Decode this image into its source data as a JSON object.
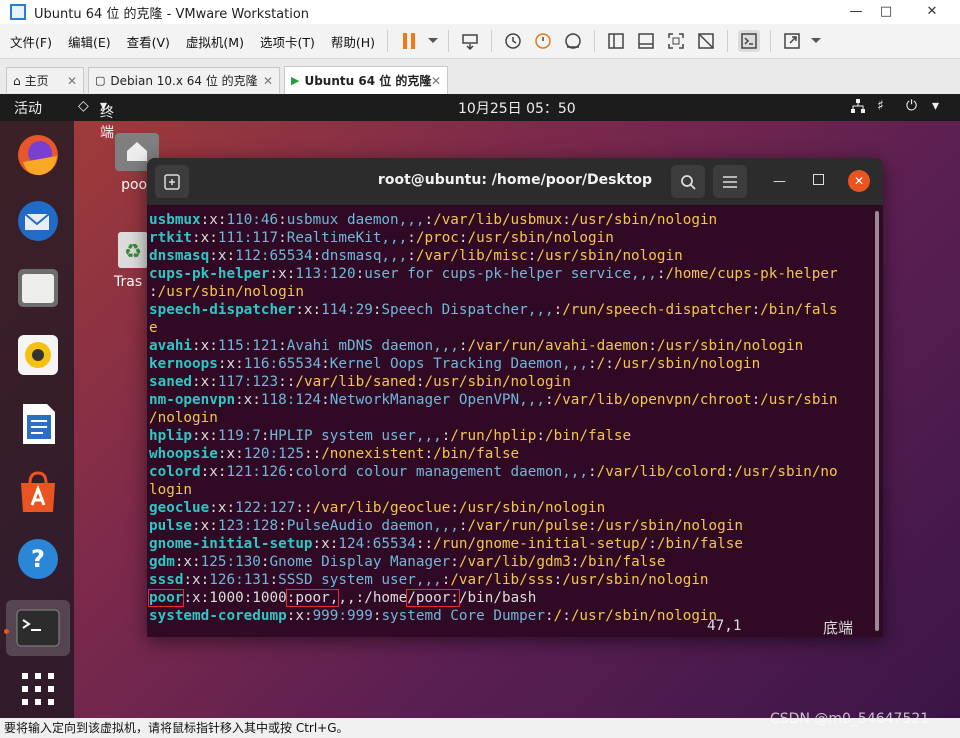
{
  "window": {
    "title": "Ubuntu 64 位 的克隆 - VMware Workstation"
  },
  "menu": [
    "文件(F)",
    "编辑(E)",
    "查看(V)",
    "虚拟机(M)",
    "选项卡(T)",
    "帮助(H)"
  ],
  "tabs": [
    {
      "label": "主页",
      "active": false
    },
    {
      "label": "Debian 10.x 64 位 的克隆",
      "active": false
    },
    {
      "label": "Ubuntu 64 位 的克隆",
      "active": true
    }
  ],
  "topbar": {
    "activities": "活动",
    "app": "终端",
    "clock": "10月25日  05：50"
  },
  "desktop": {
    "home": "poor",
    "trash": "Tras"
  },
  "terminal": {
    "title": "root@ubuntu: /home/poor/Desktop",
    "lines": [
      [
        [
          "u",
          "usbmux"
        ],
        [
          "s",
          ":x:"
        ],
        [
          "n",
          "110:46"
        ],
        [
          "s",
          ":"
        ],
        [
          "n",
          "usbmux daemon,,,"
        ],
        [
          "s",
          ":"
        ],
        [
          "d",
          "/var/lib/usbmux"
        ],
        [
          "s",
          ":"
        ],
        [
          "b",
          "/usr/sbin/nologin"
        ]
      ],
      [
        [
          "u",
          "rtkit"
        ],
        [
          "s",
          ":x:"
        ],
        [
          "n",
          "111:117"
        ],
        [
          "s",
          ":"
        ],
        [
          "n",
          "RealtimeKit,,,"
        ],
        [
          "s",
          ":"
        ],
        [
          "d",
          "/proc"
        ],
        [
          "s",
          ":"
        ],
        [
          "b",
          "/usr/sbin/nologin"
        ]
      ],
      [
        [
          "u",
          "dnsmasq"
        ],
        [
          "s",
          ":x:"
        ],
        [
          "n",
          "112:65534"
        ],
        [
          "s",
          ":"
        ],
        [
          "n",
          "dnsmasq,,,"
        ],
        [
          "s",
          ":"
        ],
        [
          "d",
          "/var/lib/misc"
        ],
        [
          "s",
          ":"
        ],
        [
          "b",
          "/usr/sbin/nologin"
        ]
      ],
      [
        [
          "u",
          "cups-pk-helper"
        ],
        [
          "s",
          ":x:"
        ],
        [
          "n",
          "113:120"
        ],
        [
          "s",
          ":"
        ],
        [
          "n",
          "user for cups-pk-helper service,,,"
        ],
        [
          "s",
          ":"
        ],
        [
          "d",
          "/home/cups-pk-helper"
        ]
      ],
      [
        [
          "s",
          ":"
        ],
        [
          "b",
          "/usr/sbin/nologin"
        ]
      ],
      [
        [
          "u",
          "speech-dispatcher"
        ],
        [
          "s",
          ":x:"
        ],
        [
          "n",
          "114:29"
        ],
        [
          "s",
          ":"
        ],
        [
          "n",
          "Speech Dispatcher,,,"
        ],
        [
          "s",
          ":"
        ],
        [
          "d",
          "/run/speech-dispatcher"
        ],
        [
          "s",
          ":"
        ],
        [
          "b",
          "/bin/fals"
        ]
      ],
      [
        [
          "b",
          "e"
        ]
      ],
      [
        [
          "u",
          "avahi"
        ],
        [
          "s",
          ":x:"
        ],
        [
          "n",
          "115:121"
        ],
        [
          "s",
          ":"
        ],
        [
          "n",
          "Avahi mDNS daemon,,,"
        ],
        [
          "s",
          ":"
        ],
        [
          "d",
          "/var/run/avahi-daemon"
        ],
        [
          "s",
          ":"
        ],
        [
          "b",
          "/usr/sbin/nologin"
        ]
      ],
      [
        [
          "u",
          "kernoops"
        ],
        [
          "s",
          ":x:"
        ],
        [
          "n",
          "116:65534"
        ],
        [
          "s",
          ":"
        ],
        [
          "n",
          "Kernel Oops Tracking Daemon,,,"
        ],
        [
          "s",
          ":"
        ],
        [
          "d",
          "/"
        ],
        [
          "s",
          ":"
        ],
        [
          "b",
          "/usr/sbin/nologin"
        ]
      ],
      [
        [
          "u",
          "saned"
        ],
        [
          "s",
          ":x:"
        ],
        [
          "n",
          "117:123"
        ],
        [
          "s",
          "::"
        ],
        [
          "d",
          "/var/lib/saned"
        ],
        [
          "s",
          ":"
        ],
        [
          "b",
          "/usr/sbin/nologin"
        ]
      ],
      [
        [
          "u",
          "nm-openvpn"
        ],
        [
          "s",
          ":x:"
        ],
        [
          "n",
          "118:124"
        ],
        [
          "s",
          ":"
        ],
        [
          "n",
          "NetworkManager OpenVPN,,,"
        ],
        [
          "s",
          ":"
        ],
        [
          "d",
          "/var/lib/openvpn/chroot"
        ],
        [
          "s",
          ":"
        ],
        [
          "b",
          "/usr/sbin"
        ]
      ],
      [
        [
          "b",
          "/nologin"
        ]
      ],
      [
        [
          "u",
          "hplip"
        ],
        [
          "s",
          ":x:"
        ],
        [
          "n",
          "119:7"
        ],
        [
          "s",
          ":"
        ],
        [
          "n",
          "HPLIP system user,,,"
        ],
        [
          "s",
          ":"
        ],
        [
          "d",
          "/run/hplip"
        ],
        [
          "s",
          ":"
        ],
        [
          "b",
          "/bin/false"
        ]
      ],
      [
        [
          "u",
          "whoopsie"
        ],
        [
          "s",
          ":x:"
        ],
        [
          "n",
          "120:125"
        ],
        [
          "s",
          "::"
        ],
        [
          "d",
          "/nonexistent"
        ],
        [
          "s",
          ":"
        ],
        [
          "b",
          "/bin/false"
        ]
      ],
      [
        [
          "u",
          "colord"
        ],
        [
          "s",
          ":x:"
        ],
        [
          "n",
          "121:126"
        ],
        [
          "s",
          ":"
        ],
        [
          "n",
          "colord colour management daemon,,,"
        ],
        [
          "s",
          ":"
        ],
        [
          "d",
          "/var/lib/colord"
        ],
        [
          "s",
          ":"
        ],
        [
          "b",
          "/usr/sbin/no"
        ]
      ],
      [
        [
          "b",
          "login"
        ]
      ],
      [
        [
          "u",
          "geoclue"
        ],
        [
          "s",
          ":x:"
        ],
        [
          "n",
          "122:127"
        ],
        [
          "s",
          "::"
        ],
        [
          "d",
          "/var/lib/geoclue"
        ],
        [
          "s",
          ":"
        ],
        [
          "b",
          "/usr/sbin/nologin"
        ]
      ],
      [
        [
          "u",
          "pulse"
        ],
        [
          "s",
          ":x:"
        ],
        [
          "n",
          "123:128"
        ],
        [
          "s",
          ":"
        ],
        [
          "n",
          "PulseAudio daemon,,,"
        ],
        [
          "s",
          ":"
        ],
        [
          "d",
          "/var/run/pulse"
        ],
        [
          "s",
          ":"
        ],
        [
          "b",
          "/usr/sbin/nologin"
        ]
      ],
      [
        [
          "u",
          "gnome-initial-setup"
        ],
        [
          "s",
          ":x:"
        ],
        [
          "n",
          "124:65534"
        ],
        [
          "s",
          "::"
        ],
        [
          "d",
          "/run/gnome-initial-setup/"
        ],
        [
          "s",
          ":"
        ],
        [
          "b",
          "/bin/false"
        ]
      ],
      [
        [
          "u",
          "gdm"
        ],
        [
          "s",
          ":x:"
        ],
        [
          "n",
          "125:130"
        ],
        [
          "s",
          ":"
        ],
        [
          "n",
          "Gnome Display Manager"
        ],
        [
          "s",
          ":"
        ],
        [
          "d",
          "/var/lib/gdm3"
        ],
        [
          "s",
          ":"
        ],
        [
          "b",
          "/bin/false"
        ]
      ],
      [
        [
          "u",
          "sssd"
        ],
        [
          "s",
          ":x:"
        ],
        [
          "n",
          "126:131"
        ],
        [
          "s",
          ":"
        ],
        [
          "n",
          "SSSD system user,,,"
        ],
        [
          "s",
          ":"
        ],
        [
          "d",
          "/var/lib/sss"
        ],
        [
          "s",
          ":"
        ],
        [
          "b",
          "/usr/sbin/nologin"
        ]
      ],
      [
        [
          "um",
          "poor"
        ],
        [
          "s",
          ":x:"
        ],
        [
          "s",
          "1000:1000"
        ],
        [
          "m",
          ":poor,"
        ],
        [
          "s",
          ",,:/home"
        ],
        [
          "m",
          "/poor:"
        ],
        [
          "s",
          "/bin/bash"
        ]
      ],
      [
        [
          "u",
          "systemd-coredump"
        ],
        [
          "s",
          ":x:"
        ],
        [
          "n",
          "999:999"
        ],
        [
          "s",
          ":"
        ],
        [
          "n",
          "systemd Core Dumper"
        ],
        [
          "s",
          ":"
        ],
        [
          "d",
          "/"
        ],
        [
          "s",
          ":"
        ],
        [
          "b",
          "/usr/sbin/nologin"
        ]
      ]
    ],
    "cursor_pos": "47,1",
    "mode": "底端"
  },
  "statusbar": "要将输入定向到该虚拟机，请将鼠标指针移入其中或按 Ctrl+G。",
  "watermark": "CSDN @m0_54647521"
}
